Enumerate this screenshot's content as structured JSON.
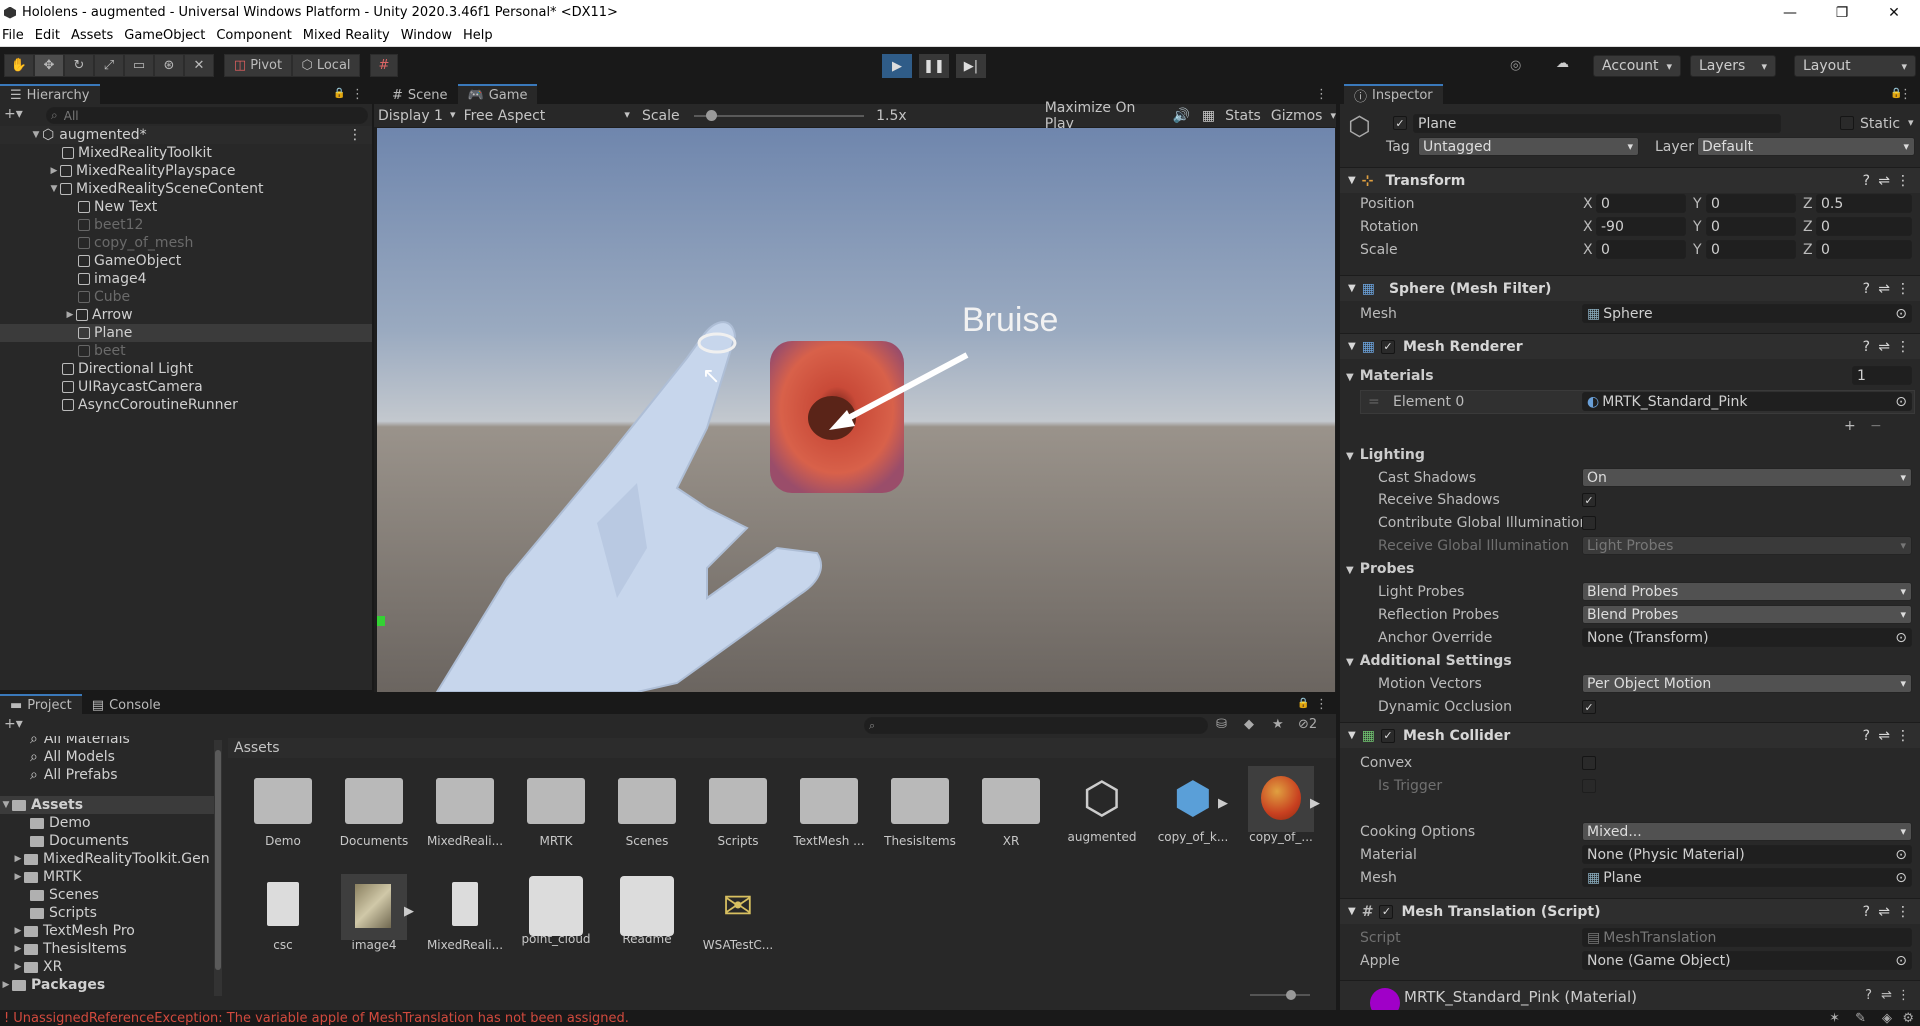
{
  "window": {
    "title": "Hololens - augmented - Universal Windows Platform - Unity 2020.3.46f1 Personal* <DX11>",
    "minimize": "—",
    "maximize": "❐",
    "close": "✕"
  },
  "menu": [
    "File",
    "Edit",
    "Assets",
    "GameObject",
    "Component",
    "Mixed Reality",
    "Window",
    "Help"
  ],
  "toolbar": {
    "pivot": "Pivot",
    "local": "Local",
    "account": "Account",
    "layers": "Layers",
    "layout": "Layout"
  },
  "hierarchy": {
    "tab": "Hierarchy",
    "search_placeholder": "All",
    "items": [
      {
        "label": "augmented*",
        "state": "normal"
      },
      {
        "label": "MixedRealityToolkit",
        "state": "normal"
      },
      {
        "label": "MixedRealityPlayspace",
        "state": "normal"
      },
      {
        "label": "MixedRealitySceneContent",
        "state": "normal"
      },
      {
        "label": "New Text",
        "state": "normal"
      },
      {
        "label": "beet12",
        "state": "dim"
      },
      {
        "label": "copy_of_mesh",
        "state": "dim"
      },
      {
        "label": "GameObject",
        "state": "normal"
      },
      {
        "label": "image4",
        "state": "normal"
      },
      {
        "label": "Cube",
        "state": "dim"
      },
      {
        "label": "Arrow",
        "state": "normal"
      },
      {
        "label": "Plane",
        "state": "selected"
      },
      {
        "label": "beet",
        "state": "dim"
      },
      {
        "label": "Directional Light",
        "state": "normal"
      },
      {
        "label": "UIRaycastCamera",
        "state": "normal"
      },
      {
        "label": "AsyncCoroutineRunner",
        "state": "normal"
      }
    ]
  },
  "scene": {
    "tab_scene": "Scene",
    "tab_game": "Game",
    "display": "Display 1",
    "aspect": "Free Aspect",
    "scale_label": "Scale",
    "scale_value": "1.5x",
    "scale_fraction": 0.1,
    "maximize": "Maximize On Play",
    "stats": "Stats",
    "gizmos": "Gizmos",
    "annotation": "Bruise"
  },
  "inspector": {
    "tab": "Inspector",
    "object_name": "Plane",
    "static": "Static",
    "tag_label": "Tag",
    "tag_value": "Untagged",
    "layer_label": "Layer",
    "layer_value": "Default",
    "transform": {
      "title": "Transform",
      "position": {
        "label": "Position",
        "x": "0",
        "y": "0",
        "z": "0.5"
      },
      "rotation": {
        "label": "Rotation",
        "x": "-90",
        "y": "0",
        "z": "0"
      },
      "scale": {
        "label": "Scale",
        "x": "0",
        "y": "0",
        "z": "0"
      }
    },
    "mesh_filter": {
      "title": "Sphere (Mesh Filter)",
      "mesh_label": "Mesh",
      "mesh_value": "Sphere"
    },
    "mesh_renderer": {
      "title": "Mesh Renderer",
      "materials_label": "Materials",
      "materials_count": "1",
      "element_label": "Element 0",
      "element_value": "MRTK_Standard_Pink",
      "lighting": "Lighting",
      "cast_shadows_label": "Cast Shadows",
      "cast_shadows_value": "On",
      "receive_shadows": "Receive Shadows",
      "contribute_gi": "Contribute Global Illumination",
      "receive_gi_label": "Receive Global Illumination",
      "receive_gi_value": "Light Probes",
      "probes": "Probes",
      "light_probes_label": "Light Probes",
      "light_probes_value": "Blend Probes",
      "reflection_probes_label": "Reflection Probes",
      "reflection_probes_value": "Blend Probes",
      "anchor_label": "Anchor Override",
      "anchor_value": "None (Transform)",
      "additional": "Additional Settings",
      "motion_label": "Motion Vectors",
      "motion_value": "Per Object Motion",
      "dynamic_occlusion": "Dynamic Occlusion"
    },
    "mesh_collider": {
      "title": "Mesh Collider",
      "convex": "Convex",
      "is_trigger": "Is Trigger",
      "cooking_label": "Cooking Options",
      "cooking_value": "Mixed...",
      "material_label": "Material",
      "material_value": "None (Physic Material)",
      "mesh_label": "Mesh",
      "mesh_value": "Plane"
    },
    "script": {
      "title": "Mesh Translation (Script)",
      "script_label": "Script",
      "script_value": "MeshTranslation",
      "apple_label": "Apple",
      "apple_value": "None (Game Object)"
    },
    "material_footer": "MRTK_Standard_Pink (Material)"
  },
  "project": {
    "tab_project": "Project",
    "tab_console": "Console",
    "hidden_count": "2",
    "favorites": [
      "All Materials",
      "All Models",
      "All Prefabs"
    ],
    "tree_root": "Assets",
    "tree": [
      "Demo",
      "Documents",
      "MixedRealityToolkit.Gen",
      "MRTK",
      "Scenes",
      "Scripts",
      "TextMesh Pro",
      "ThesisItems",
      "XR"
    ],
    "packages": "Packages",
    "breadcrumb": "Assets",
    "assets_row1": [
      "Demo",
      "Documents",
      "MixedReali...",
      "MRTK",
      "Scenes",
      "Scripts",
      "TextMesh ...",
      "ThesisItems",
      "XR",
      "augmented",
      "copy_of_k...",
      "copy_of_..."
    ],
    "assets_row2": [
      "csc",
      "image4",
      "MixedReali...",
      "point_cloud",
      "Readme",
      "WSATestC..."
    ]
  },
  "status": {
    "error": "UnassignedReferenceException: The variable apple of MeshTranslation has not been assigned."
  },
  "colors": {
    "accent": "#3a79bb",
    "error": "#d24a3e",
    "play": "#2f5c88"
  }
}
